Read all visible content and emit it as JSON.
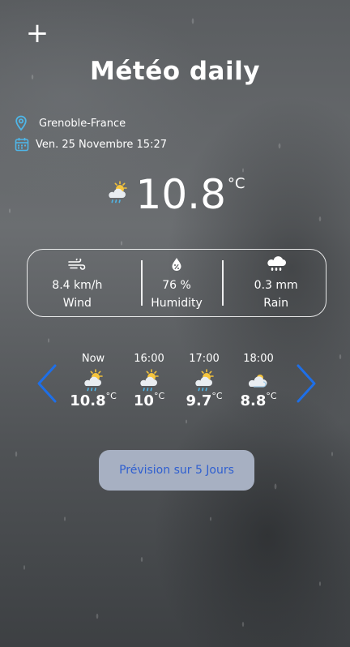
{
  "header": {
    "add_label": "+",
    "title": "Météo daily"
  },
  "location": {
    "icon": "location-pin-icon",
    "city": "Grenoble-France"
  },
  "date": {
    "icon": "calendar-icon",
    "text": "Ven. 25 Novembre 15:27"
  },
  "current": {
    "icon": "sun-cloud-rain-icon",
    "temperature": "10.8",
    "unit": "°C"
  },
  "stats": [
    {
      "icon": "wind-icon",
      "value": "8.4 km/h",
      "label": "Wind"
    },
    {
      "icon": "humidity-icon",
      "value": "76 %",
      "label": "Humidity"
    },
    {
      "icon": "rain-cloud-icon",
      "value": "0.3 mm",
      "label": "Rain"
    }
  ],
  "hourly": [
    {
      "time": "Now",
      "icon": "sun-cloud-rain-icon",
      "temp": "10.8",
      "unit": "°C"
    },
    {
      "time": "16:00",
      "icon": "sun-cloud-rain-icon",
      "temp": "10",
      "unit": "°C"
    },
    {
      "time": "17:00",
      "icon": "sun-cloud-rain-icon",
      "temp": "9.7",
      "unit": "°C"
    },
    {
      "time": "18:00",
      "icon": "cloudy-icon",
      "temp": "8.8",
      "unit": "°C"
    }
  ],
  "forecast_button": {
    "label": "Prévision sur 5 Jours"
  },
  "colors": {
    "accent_blue": "#1e6fe8",
    "button_bg": "#a7b0c2",
    "button_text": "#2f5fd0",
    "icon_blue": "#4fb6e8"
  }
}
